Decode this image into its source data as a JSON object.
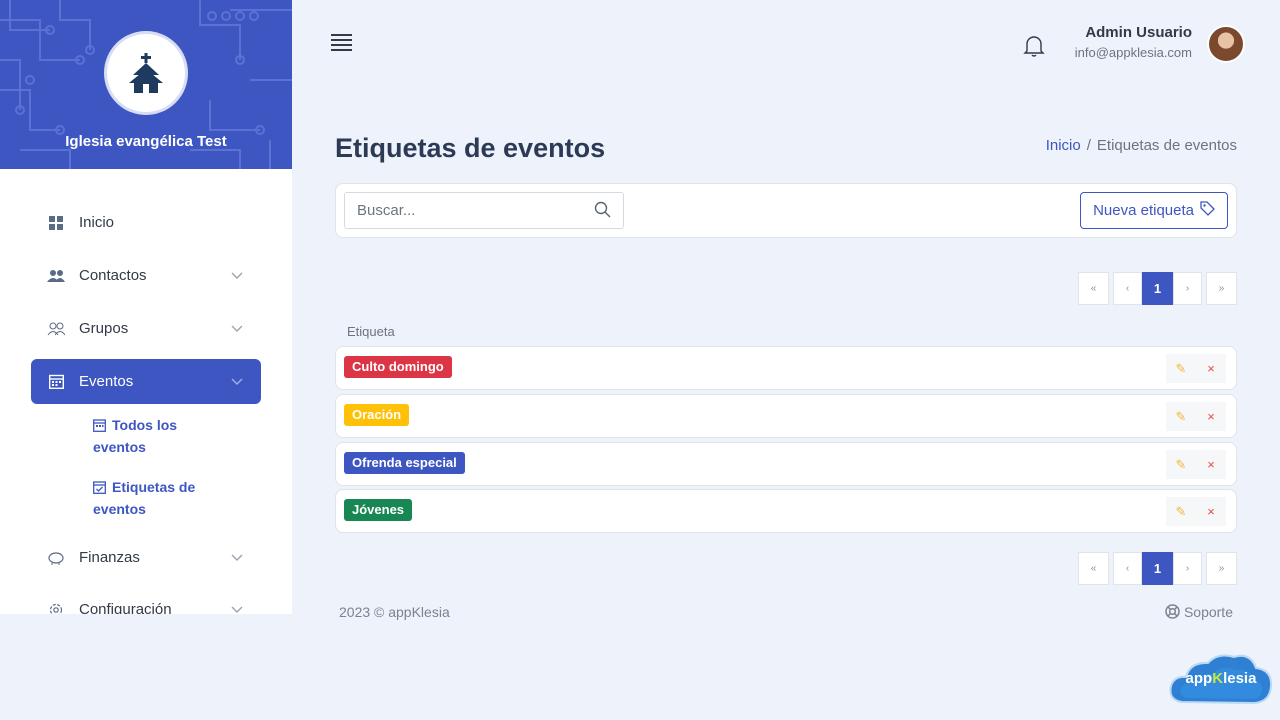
{
  "sidebar": {
    "church_name": "Iglesia evangélica Test",
    "items": [
      {
        "label": "Inicio",
        "icon": "grid-icon"
      },
      {
        "label": "Contactos",
        "icon": "users-icon"
      },
      {
        "label": "Grupos",
        "icon": "group-icon"
      },
      {
        "label": "Eventos",
        "icon": "calendar-icon"
      },
      {
        "label": "Finanzas",
        "icon": "piggy-bank-icon"
      },
      {
        "label": "Configuración",
        "icon": "gear-icon"
      }
    ],
    "subitems": [
      {
        "label": "Todos los eventos",
        "icon": "calendar-icon"
      },
      {
        "label": "Etiquetas de eventos",
        "icon": "calendar-check-icon"
      }
    ]
  },
  "header": {
    "user_name": "Admin Usuario",
    "user_email": "info@appklesia.com"
  },
  "page": {
    "title": "Etiquetas de eventos",
    "breadcrumb": {
      "home": "Inicio",
      "sep": "/",
      "current": "Etiquetas de eventos"
    }
  },
  "toolbar": {
    "search_placeholder": "Buscar...",
    "new_button": "Nueva etiqueta"
  },
  "pagination": {
    "first": "«",
    "prev": "‹",
    "current": "1",
    "next": "›",
    "last": "»"
  },
  "table": {
    "column": "Etiqueta",
    "rows": [
      {
        "label": "Culto domingo",
        "color": "#dc3545"
      },
      {
        "label": "Oración",
        "color": "#ffc107"
      },
      {
        "label": "Ofrenda especial",
        "color": "#3d56c2"
      },
      {
        "label": "Jóvenes",
        "color": "#198754"
      }
    ],
    "edit_glyph": "✎",
    "delete_glyph": "×"
  },
  "footer": {
    "copyright": "2023 © appKlesia",
    "support": "Soporte"
  },
  "brand": {
    "prefix": "app",
    "k": "K",
    "suffix": "lesia"
  }
}
